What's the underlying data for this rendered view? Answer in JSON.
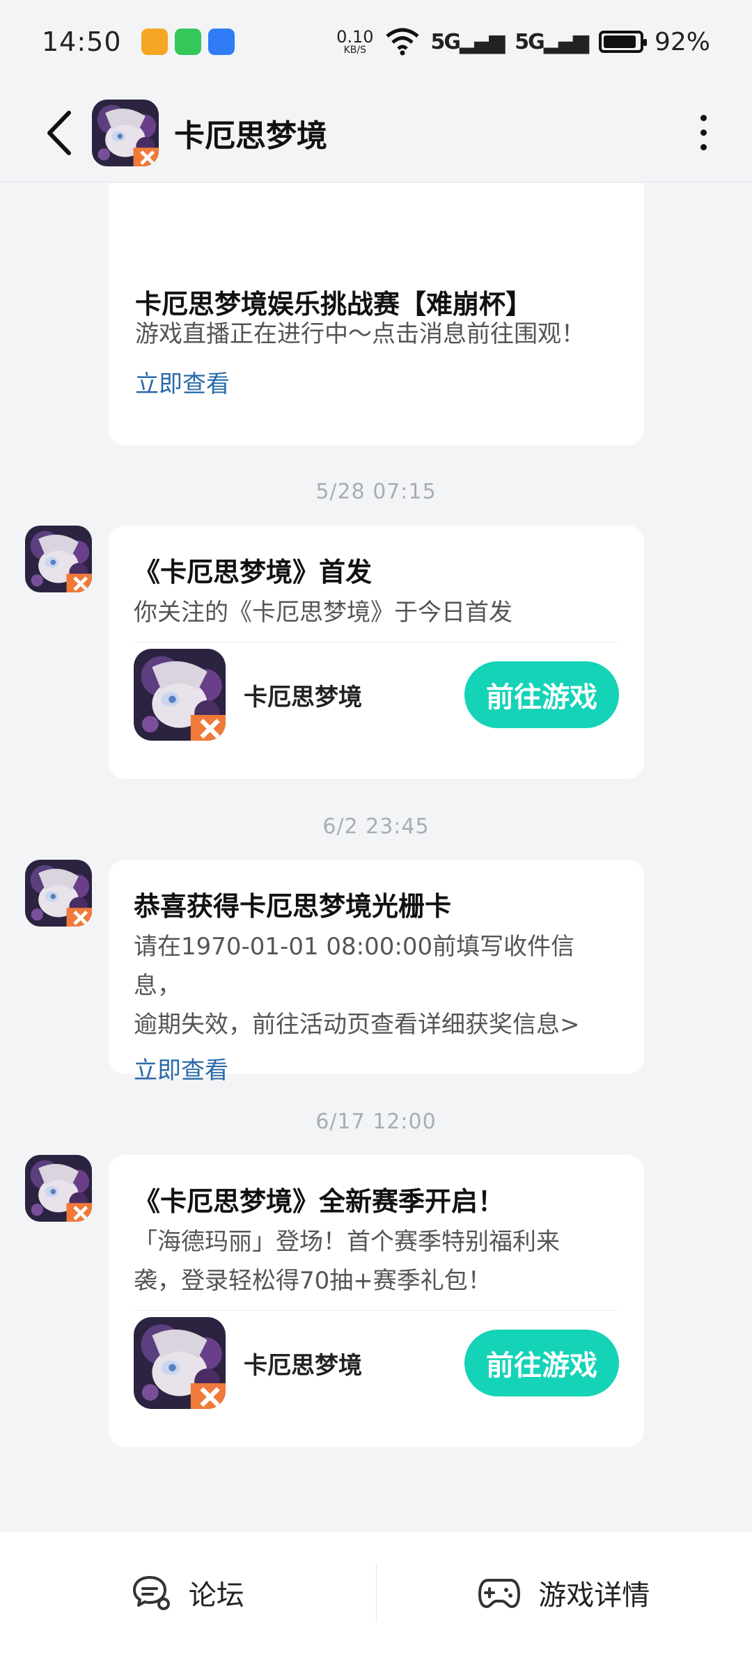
{
  "status_bar": {
    "time": "14:50",
    "net_speed_value": "0.10",
    "net_speed_unit": "KB/S",
    "signal1": "5G",
    "signal2": "5G",
    "battery_level": 0.92,
    "battery_text": "92%",
    "app_icons": [
      "video-app-icon",
      "chat-app-icon",
      "sync-app-icon"
    ]
  },
  "header": {
    "title": "卡厄思梦境",
    "back_icon": "chevron-left-icon",
    "more_icon": "more-vertical-icon"
  },
  "messages": [
    {
      "title": "卡厄思梦境娱乐挑战赛【难崩杯】",
      "body": "游戏直播正在进行中～点击消息前往围观！",
      "link": "立即查看"
    },
    {
      "timestamp": "5/28   07:15",
      "title": "《卡厄思梦境》首发",
      "body": "你关注的《卡厄思梦境》于今日首发",
      "game_name": "卡厄思梦境",
      "button": "前往游戏"
    },
    {
      "timestamp": "6/2   23:45",
      "title": "恭喜获得卡厄思梦境光栅卡",
      "body_line1": "请在1970-01-01 08:00:00前填写收件信息，",
      "body_line2": "逾期失效，前往活动页查看详细获奖信息>",
      "link": "立即查看"
    },
    {
      "timestamp": "6/17   12:00",
      "title": "《卡厄思梦境》全新赛季开启！",
      "body_line1": "「海德玛丽」登场！首个赛季特别福利来",
      "body_line2": "袭，登录轻松得70抽+赛季礼包！",
      "game_name": "卡厄思梦境",
      "button": "前往游戏"
    }
  ],
  "bottom_nav": {
    "forum_label": "论坛",
    "details_label": "游戏详情"
  },
  "colors": {
    "accent": "#15d3b7",
    "link": "#2a6aa8",
    "background": "#f3f4f6"
  }
}
